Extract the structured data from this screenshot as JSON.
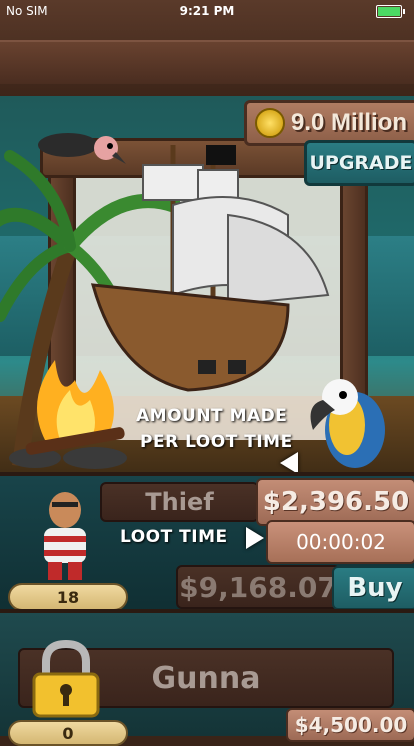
{
  "status_bar": {
    "carrier": "No SIM",
    "time": "9:21 PM"
  },
  "currency": {
    "amount": "9.0 Million",
    "icon": "gold-coin-icon"
  },
  "upgrade_button": {
    "label": "UPGRADE"
  },
  "tutorial": {
    "amount_line1": "AMOUNT MADE",
    "amount_line2": "PER LOOT TIME",
    "loot_time": "LOOT TIME"
  },
  "businesses": [
    {
      "name": "Thief",
      "earning": "$2,396.50",
      "timer": "00:00:02",
      "price": "$9,168.07",
      "buy_label": "Buy",
      "level": "18"
    },
    {
      "name": "Gunna",
      "price": "$4,500.00",
      "level": "0",
      "locked": true
    }
  ],
  "colors": {
    "wood": "#6a4330",
    "teal": "#2a7c83",
    "money_plank": "#c38d76"
  }
}
